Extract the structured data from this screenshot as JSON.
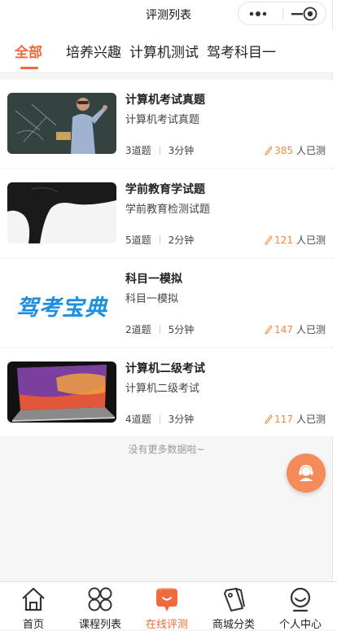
{
  "header": {
    "title": "评测列表"
  },
  "tabs": [
    {
      "label": "全部",
      "active": true
    },
    {
      "label": "培养兴趣",
      "active": false
    },
    {
      "label": "计算机测试",
      "active": false
    },
    {
      "label": "驾考科目一",
      "active": false
    }
  ],
  "items": [
    {
      "title": "计算机考试真题",
      "subtitle": "计算机考试真题",
      "questions": "3道题",
      "duration": "3分钟",
      "count": "385",
      "count_suffix": "人已测",
      "thumb": "teacher-blackboard-image"
    },
    {
      "title": "学前教育学试题",
      "subtitle": "学前教育检测试题",
      "questions": "5道题",
      "duration": "2分钟",
      "count": "121",
      "count_suffix": "人已测",
      "thumb": "abstract-black-white-image"
    },
    {
      "title": "科目一模拟",
      "subtitle": "科目一模拟",
      "questions": "2道题",
      "duration": "5分钟",
      "count": "147",
      "count_suffix": "人已测",
      "thumb": "jiakao-baodian-logo",
      "logo_text": "驾考宝典"
    },
    {
      "title": "计算机二级考试",
      "subtitle": "计算机二级考试",
      "questions": "4道题",
      "duration": "3分钟",
      "count": "117",
      "count_suffix": "人已测",
      "thumb": "laptop-image"
    }
  ],
  "footer_note": "没有更多数据啦~",
  "bottom_nav": [
    {
      "label": "首页",
      "icon": "home-icon",
      "active": false
    },
    {
      "label": "课程列表",
      "icon": "grid-icon",
      "active": false
    },
    {
      "label": "在线评测",
      "icon": "chat-bubble-icon",
      "active": true
    },
    {
      "label": "商城分类",
      "icon": "tag-icon",
      "active": false
    },
    {
      "label": "个人中心",
      "icon": "user-icon",
      "active": false
    }
  ],
  "colors": {
    "accent": "#f06a3c",
    "count": "#f0873c",
    "float_button": "#f58a5a"
  }
}
